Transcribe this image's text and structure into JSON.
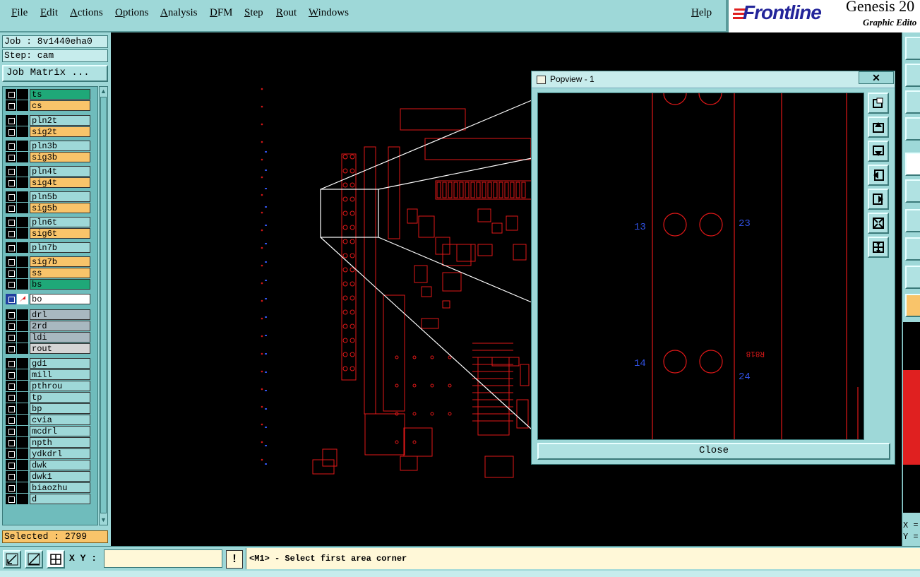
{
  "menubar": {
    "items": [
      "File",
      "Edit",
      "Actions",
      "Options",
      "Analysis",
      "DFM",
      "Step",
      "Rout",
      "Windows"
    ],
    "help": "Help"
  },
  "logo": {
    "name": "Frontline",
    "product": "Genesis 20",
    "subtitle": "Graphic Edito"
  },
  "job": {
    "job_label": "Job : 8v1440eha0",
    "step_label": "Step: cam",
    "matrix_button": "Job Matrix ..."
  },
  "layers": [
    {
      "name": "ts",
      "color": "#1fa878"
    },
    {
      "name": "cs",
      "color": "#f9c46a"
    },
    {
      "name": "pln2t",
      "color": "#9ed8d8"
    },
    {
      "name": "sig2t",
      "color": "#f9c46a"
    },
    {
      "name": "pln3b",
      "color": "#9ed8d8"
    },
    {
      "name": "sig3b",
      "color": "#f9c46a"
    },
    {
      "name": "pln4t",
      "color": "#9ed8d8"
    },
    {
      "name": "sig4t",
      "color": "#f9c46a"
    },
    {
      "name": "pln5b",
      "color": "#9ed8d8"
    },
    {
      "name": "sig5b",
      "color": "#f9c46a"
    },
    {
      "name": "pln6t",
      "color": "#9ed8d8"
    },
    {
      "name": "sig6t",
      "color": "#f9c46a"
    },
    {
      "name": "pln7b",
      "color": "#9ed8d8"
    },
    {
      "name": "sig7b",
      "color": "#f9c46a"
    },
    {
      "name": "ss",
      "color": "#f9c46a"
    },
    {
      "name": "bs",
      "color": "#1fa878"
    },
    {
      "name": "bo",
      "color": "#ffffff"
    },
    {
      "name": "drl",
      "color": "#a8b8c0"
    },
    {
      "name": "2rd",
      "color": "#a8b8c0"
    },
    {
      "name": "ldi",
      "color": "#a8b8c0"
    },
    {
      "name": "rout",
      "color": "#d4d4d4"
    },
    {
      "name": "gd1",
      "color": "#9ed8d8"
    },
    {
      "name": "mill",
      "color": "#9ed8d8"
    },
    {
      "name": "pthrou",
      "color": "#9ed8d8"
    },
    {
      "name": "tp",
      "color": "#9ed8d8"
    },
    {
      "name": "bp",
      "color": "#9ed8d8"
    },
    {
      "name": "cvia",
      "color": "#9ed8d8"
    },
    {
      "name": "mcdrl",
      "color": "#9ed8d8"
    },
    {
      "name": "npth",
      "color": "#9ed8d8"
    },
    {
      "name": "ydkdrl",
      "color": "#9ed8d8"
    },
    {
      "name": "dwk",
      "color": "#9ed8d8"
    },
    {
      "name": "dwk1",
      "color": "#9ed8d8"
    },
    {
      "name": "biaozhu",
      "color": "#9ed8d8"
    },
    {
      "name": "d",
      "color": "#9ed8d8"
    }
  ],
  "selected": "Selected : 2799",
  "popview": {
    "title": "Popview - 1",
    "close_x": "✕",
    "close_button": "Close",
    "labels": {
      "pin13": "13",
      "pin14": "14",
      "pin23": "23",
      "pin24": "24",
      "ref": "R818"
    }
  },
  "statusbar": {
    "xy_label": "X Y :",
    "xy_value": "",
    "bang": "!",
    "prompt": "<M1> - Select first area corner"
  },
  "readout": {
    "x": "X =",
    "y": "Y ="
  },
  "colors": {
    "panel": "#9ed8d8",
    "trace": "#e01818",
    "text_blue": "#3050e0"
  }
}
